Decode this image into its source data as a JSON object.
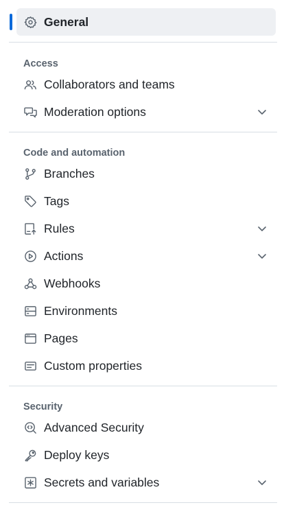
{
  "general": {
    "label": "General",
    "icon": "gear-icon",
    "selected": true,
    "accent_color": "#0969da"
  },
  "sections": {
    "access": {
      "title": "Access",
      "items": [
        {
          "label": "Collaborators and teams",
          "icon": "people-icon"
        },
        {
          "label": "Moderation options",
          "icon": "comment-discussion-icon",
          "expandable": true
        }
      ]
    },
    "code_automation": {
      "title": "Code and automation",
      "items": [
        {
          "label": "Branches",
          "icon": "git-branch-icon"
        },
        {
          "label": "Tags",
          "icon": "tag-icon"
        },
        {
          "label": "Rules",
          "icon": "repo-push-icon",
          "expandable": true
        },
        {
          "label": "Actions",
          "icon": "play-icon",
          "expandable": true
        },
        {
          "label": "Webhooks",
          "icon": "webhook-icon"
        },
        {
          "label": "Environments",
          "icon": "server-icon"
        },
        {
          "label": "Pages",
          "icon": "browser-icon"
        },
        {
          "label": "Custom properties",
          "icon": "note-icon"
        }
      ]
    },
    "security": {
      "title": "Security",
      "items": [
        {
          "label": "Advanced Security",
          "icon": "codescan-icon"
        },
        {
          "label": "Deploy keys",
          "icon": "key-icon"
        },
        {
          "label": "Secrets and variables",
          "icon": "asterisk-icon",
          "expandable": true
        }
      ]
    }
  }
}
